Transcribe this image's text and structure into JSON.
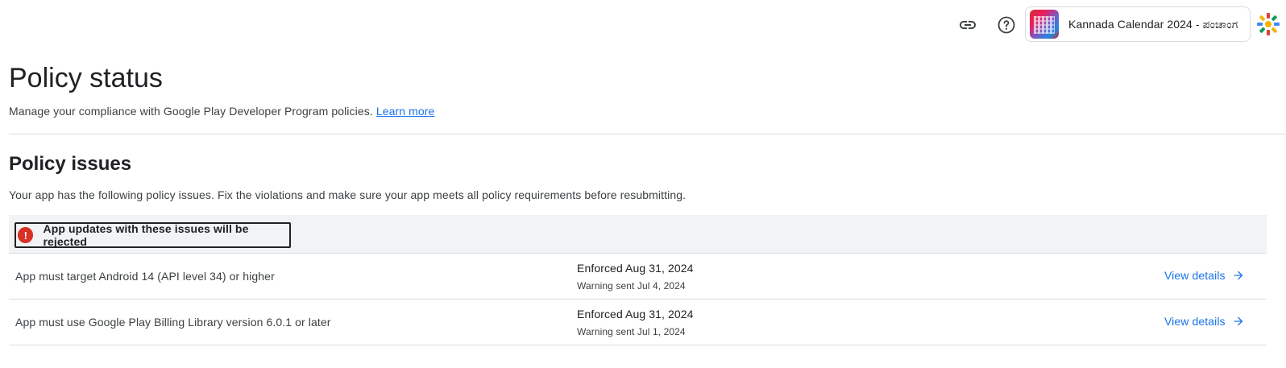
{
  "topbar": {
    "app_name": "Kannada Calendar 2024 - ಪಂಚಾಂಗ",
    "icons": [
      "link-icon",
      "help-icon"
    ]
  },
  "header": {
    "title": "Policy status",
    "subtitle": "Manage your compliance with Google Play Developer Program policies.",
    "learn_more": "Learn more"
  },
  "section": {
    "title": "Policy issues",
    "description": "Your app has the following policy issues. Fix the violations and make sure your app meets all policy requirements before resubmitting.",
    "alert_label": "App updates with these issues will be rejected",
    "alert_color": "#d93025"
  },
  "issues": [
    {
      "title": "App must target Android 14 (API level 34) or higher",
      "enforced": "Enforced Aug 31, 2024",
      "warning": "Warning sent Jul 4, 2024",
      "link": "View details"
    },
    {
      "title": "App must use Google Play Billing Library version 6.0.1 or later",
      "enforced": "Enforced Aug 31, 2024",
      "warning": "Warning sent Jul 1, 2024",
      "link": "View details"
    }
  ],
  "colors": {
    "link": "#1a73e8",
    "header_bg": "#f1f3f4"
  }
}
